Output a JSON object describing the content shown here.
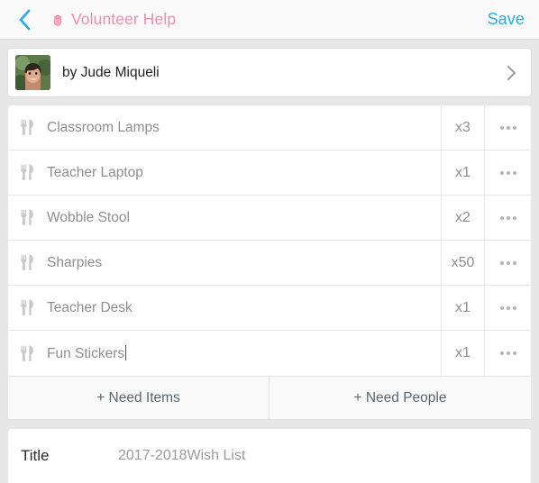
{
  "header": {
    "back_icon": "chevron-left-icon",
    "hand_icon": "raised-hand-icon",
    "title": "Volunteer Help",
    "save_label": "Save",
    "accent_blue": "#29abe2",
    "title_pink": "#f489ab"
  },
  "author": {
    "avatar_icon": "user-photo-avatar",
    "name": "by Jude Miqueli",
    "chevron_icon": "chevron-right-icon"
  },
  "items": [
    {
      "icon": "cutlery-icon",
      "name": "Classroom Lamps",
      "qty": "x3",
      "menu": "overflow-menu-icon",
      "editing": false
    },
    {
      "icon": "cutlery-icon",
      "name": "Teacher Laptop",
      "qty": "x1",
      "menu": "overflow-menu-icon",
      "editing": false
    },
    {
      "icon": "cutlery-icon",
      "name": "Wobble Stool",
      "qty": "x2",
      "menu": "overflow-menu-icon",
      "editing": false
    },
    {
      "icon": "cutlery-icon",
      "name": "Sharpies",
      "qty": "x50",
      "menu": "overflow-menu-icon",
      "editing": false
    },
    {
      "icon": "cutlery-icon",
      "name": "Teacher Desk",
      "qty": "x1",
      "menu": "overflow-menu-icon",
      "editing": false
    },
    {
      "icon": "cutlery-icon",
      "name": "Fun Stickers",
      "qty": "x1",
      "menu": "overflow-menu-icon",
      "editing": true
    }
  ],
  "actions": {
    "need_items_label": "+ Need Items",
    "need_people_label": "+ Need People"
  },
  "title_field": {
    "label": "Title",
    "value": "2017-2018Wish List"
  }
}
